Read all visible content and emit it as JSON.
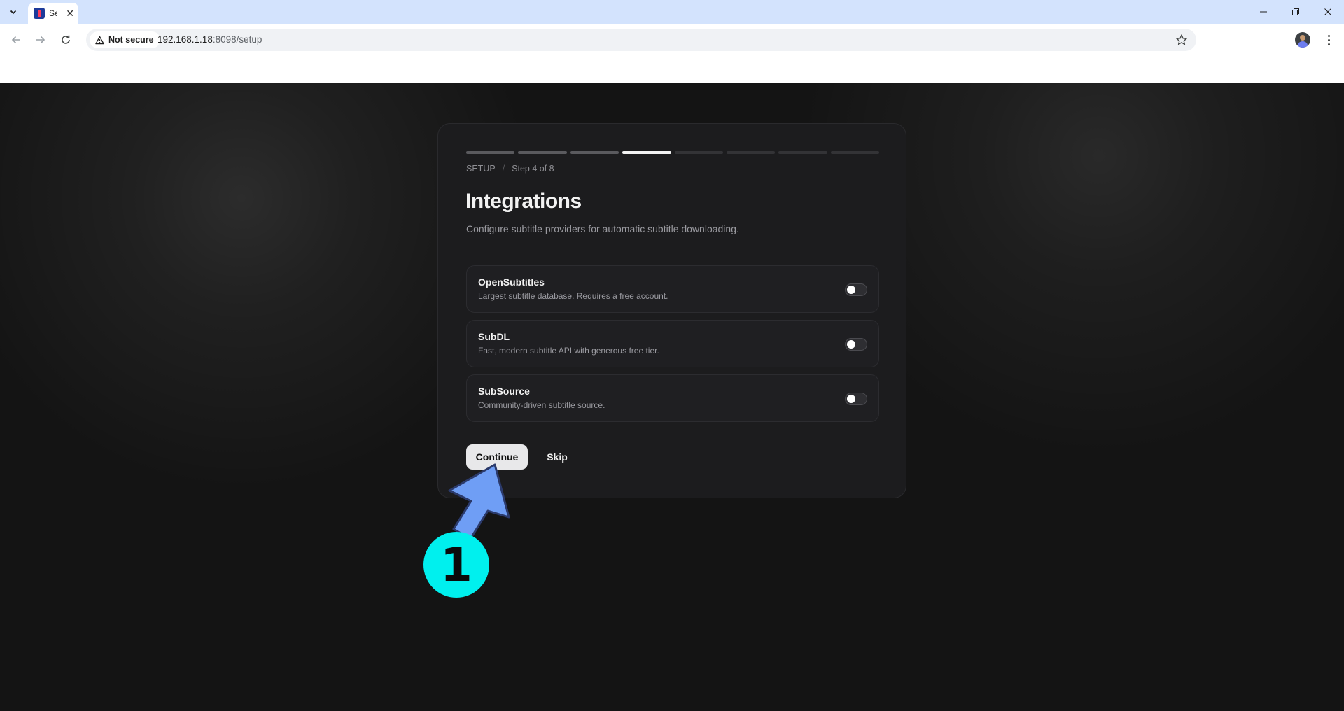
{
  "browser": {
    "tab_title": "Se",
    "tab_close": "✕",
    "security_label": "Not secure",
    "url_host": "192.168.1.18",
    "url_path": ":8098/setup"
  },
  "setup": {
    "total_steps": 8,
    "current_step": 4,
    "breadcrumb_root": "SETUP",
    "breadcrumb_separator": "/",
    "breadcrumb_step": "Step 4 of 8",
    "title": "Integrations",
    "subtitle": "Configure subtitle providers for automatic subtitle downloading.",
    "providers": [
      {
        "name": "OpenSubtitles",
        "description": "Largest subtitle database. Requires a free account.",
        "enabled": false
      },
      {
        "name": "SubDL",
        "description": "Fast, modern subtitle API with generous free tier.",
        "enabled": false
      },
      {
        "name": "SubSource",
        "description": "Community-driven subtitle source.",
        "enabled": false
      }
    ],
    "continue_label": "Continue",
    "skip_label": "Skip"
  },
  "annotation": {
    "step_number": "1",
    "color": "#00f0ee",
    "arrow_color": "#6f9ef5"
  }
}
